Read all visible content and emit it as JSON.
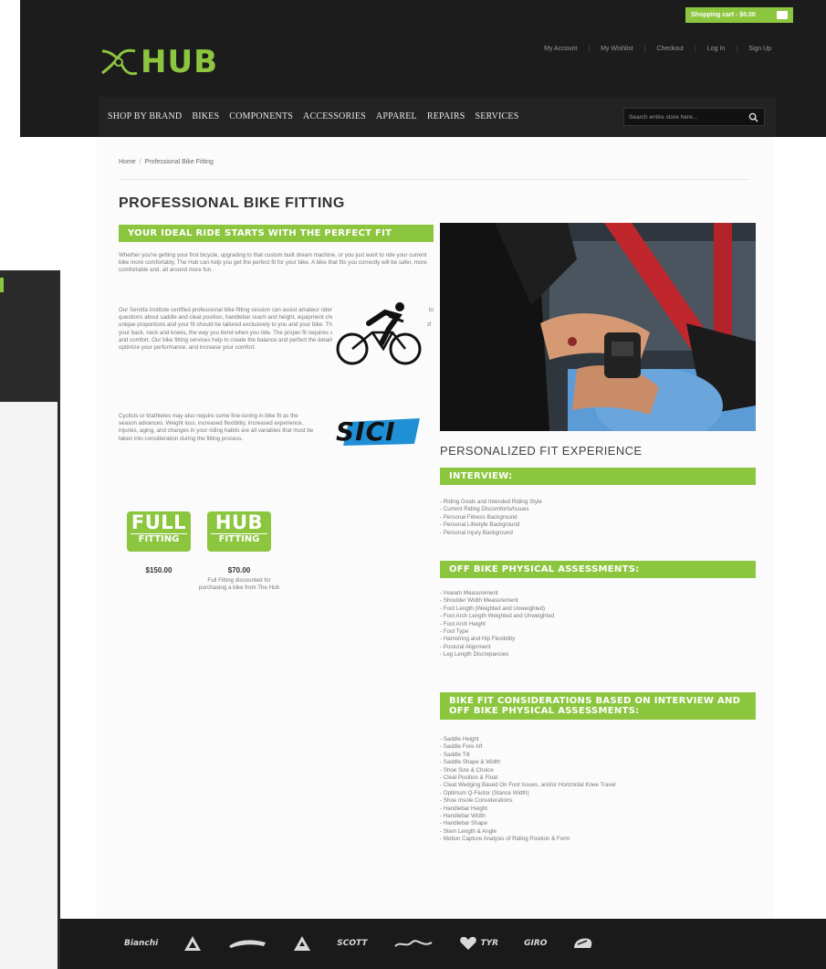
{
  "header": {
    "cart_label": "Shopping cart - $0.00",
    "logo_text": "HUB",
    "account_links": [
      "My Account",
      "My Wishlist",
      "Checkout",
      "Log In",
      "Sign Up"
    ],
    "nav": [
      "SHOP BY BRAND",
      "BIKES",
      "COMPONENTS",
      "ACCESSORIES",
      "APPAREL",
      "REPAIRS",
      "SERVICES"
    ],
    "search_placeholder": "Search entire store here..."
  },
  "breadcrumb": {
    "home": "Home",
    "current": "Professional Bike Fitting"
  },
  "page_title": "PROFESSIONAL BIKE FITTING",
  "intro_banner": "YOUR IDEAL RIDE STARTS WITH THE PERFECT FIT",
  "paragraphs": [
    "Whether you're getting your first bicycle, upgrading to that custom built dream machine, or you just want to ride your current bike more comfortably, The Hub can help you get the perfect fit for your bike. A bike that fits you correctly will be safer, more comfortable and, all around more fun.",
    "Our Serotta Institute certified professional bike fitting session can assist amateur riders and athletes alike in finding answers to questions about saddle and cleat position, handlebar reach and height, equipment choices, and more. Everyone's body has unique proportions and your fit should be tailored exclusively to you and your bike. The length of your torso, the positioning of your back, neck and knees, the way you bend when you ride. The proper fit requires a unique balance of efficiency, power, and comfort. Our bike fitting services help to create the balance and perfect the details of your alignment to avoid injury, optimize your performance, and increase your comfort.",
    "Cyclists or triathletes may also require some fine-tuning in bike fit as the season advances. Weight loss, increased flexibility, increased experience, injuries, aging, and changes in your riding habits are all variables that must be taken into consideration during the fitting process."
  ],
  "sici_logo": "SICI",
  "pricing": {
    "full_badge_big": "FULL",
    "full_badge_small": "FITTING",
    "hub_badge_big": "HUB",
    "hub_badge_small": "FITTING",
    "full_price": "$150.00",
    "hub_price": "$70.00",
    "hub_note": "Full Fitting discounted for purchasing a bike from The Hub"
  },
  "fit_heading": "PERSONALIZED FIT EXPERIENCE",
  "sections": [
    {
      "title": "INTERVIEW:",
      "items": [
        "Riding Goals and Intended Riding Style",
        "Current Riding Discomforts/Issues",
        "Personal Fitness Background",
        "Personal Lifestyle Background",
        "Personal Injury Background"
      ]
    },
    {
      "title": "OFF BIKE PHYSICAL ASSESSMENTS:",
      "items": [
        "Inseam Measurement",
        "Shoulder Width Measurement",
        "Foot Length (Weighted and Unweighted)",
        "Foot Arch Length Weighted and Unweighted",
        "Foot Arch Height",
        "Foot Type",
        "Hamstring and Hip Flexibility",
        "Postural Alignment",
        "Leg Length Discrepancies"
      ]
    },
    {
      "title": "BIKE FIT CONSIDERATIONS BASED ON INTERVIEW AND OFF BIKE PHYSICAL ASSESSMENTS:",
      "items": [
        "Saddle Height",
        "Saddle Fore Aft",
        "Saddle Tilt",
        "Saddle Shape & Width",
        "Shoe Size & Choice",
        "Cleat Position & Float",
        "Cleat Wedging Based On Foot Issues, and/or Horizontal Knee Travel",
        "Optimum Q-Factor (Stance Width)",
        "Shoe Insole Considerations",
        "Handlebar Height",
        "Handlebar Width",
        "Handlebar Shape",
        "Stem Length & Angle",
        "Motion Capture Analysis of Riding Position & Form"
      ]
    }
  ],
  "brands": [
    "Bianchi",
    "SCOTT",
    "TYR",
    "GIRO"
  ],
  "colors": {
    "accent": "#8cc63f",
    "header": "#1c1c1c",
    "footer": "#1a1a1a"
  }
}
